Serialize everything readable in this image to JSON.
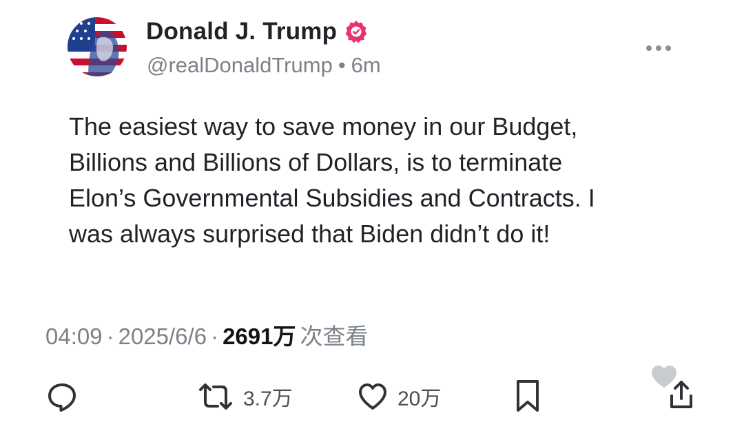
{
  "post": {
    "author": {
      "display_name": "Donald J. Trump",
      "handle": "@realDonaldTrump",
      "separator": "•",
      "time_ago": "6m",
      "verified_icon": "verified-badge-icon",
      "verified_color": "#e8336d"
    },
    "body_lines": [
      "The easiest way to save money in our Budget,",
      "Billions and Billions of Dollars, is to terminate",
      "Elon’s Governmental Subsidies and Contracts. I",
      "was always surprised that Biden didn’t do it!"
    ],
    "meta": {
      "time": "04:09",
      "dot1": "·",
      "date": "2025/6/6",
      "dot2": "·",
      "views_count": "2691万",
      "views_label": "次查看"
    },
    "actions": {
      "reply_icon": "reply-icon",
      "repost_icon": "repost-icon",
      "repost_count": "3.7万",
      "like_icon": "heart-icon",
      "like_count": "20万",
      "bookmark_icon": "bookmark-icon",
      "share_icon": "share-icon"
    },
    "more_icon": "more-options-icon"
  }
}
